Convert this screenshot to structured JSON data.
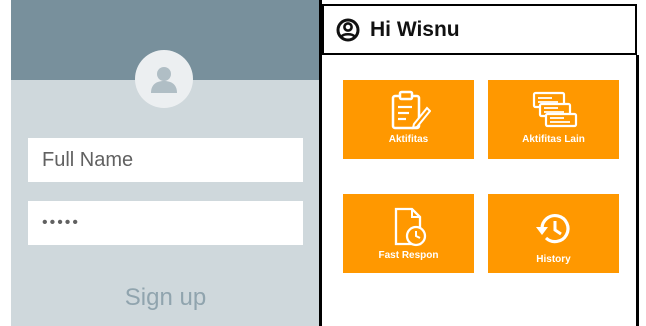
{
  "signup": {
    "full_name_placeholder": "Full Name",
    "password_value": "•••••",
    "submit_label": "Sign up"
  },
  "dashboard": {
    "greeting": "Hi Wisnu",
    "tiles": [
      {
        "label": "Aktifitas",
        "icon": "clipboard-edit-icon"
      },
      {
        "label": "Aktifitas Lain",
        "icon": "stacked-documents-icon"
      },
      {
        "label": "Fast Respon",
        "icon": "document-clock-icon"
      },
      {
        "label": "History",
        "icon": "history-clock-icon"
      }
    ]
  },
  "colors": {
    "banner": "#78909c",
    "form_background": "#cfd8dc",
    "tile": "#ff9800",
    "tile_text": "#ffffff"
  }
}
